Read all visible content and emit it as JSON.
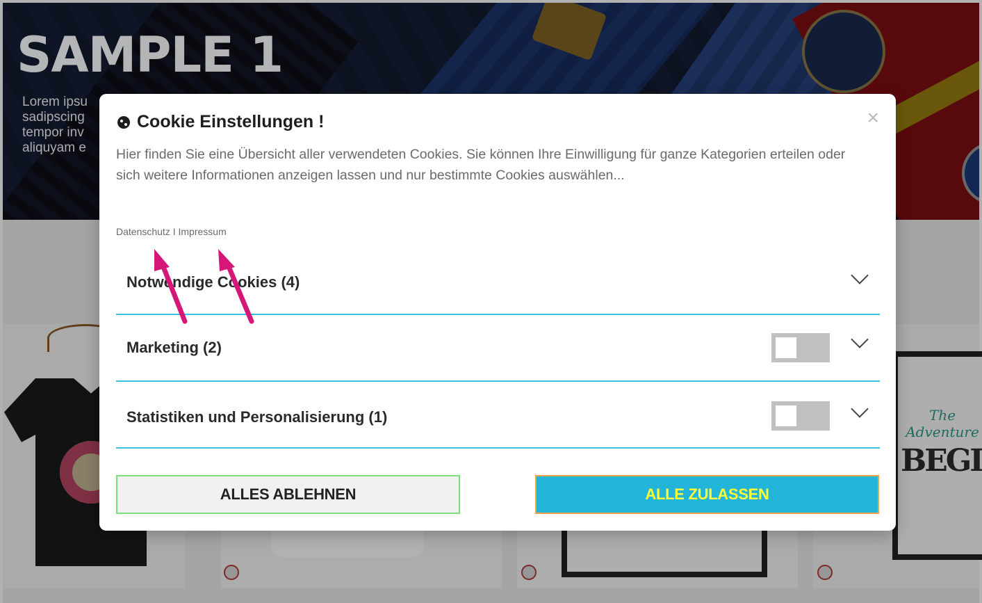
{
  "hero": {
    "title": "SAMPLE 1",
    "text": "Lorem ipsu\nsadipscing\ntempor inv\naliquyam e"
  },
  "modal": {
    "title": "Cookie Einstellungen !",
    "close": "×",
    "intro": "Hier finden Sie eine Übersicht aller verwendeten Cookies. Sie können Ihre Einwilligung für ganze Kategorien erteilen oder sich weitere Informationen anzeigen lassen und nur bestimmte Cookies auswählen...",
    "links": {
      "privacy": "Datenschutz",
      "separator": " I ",
      "imprint": "Impressum"
    },
    "categories": [
      {
        "label": "Notwendige Cookies (4)",
        "has_toggle": false
      },
      {
        "label": "Marketing (2)",
        "has_toggle": true,
        "enabled": false
      },
      {
        "label": "Statistiken und Personalisierung (1)",
        "has_toggle": true,
        "enabled": false
      }
    ],
    "buttons": {
      "reject": "ALLES ABLEHNEN",
      "accept": "ALLE ZULASSEN"
    }
  },
  "poster": {
    "small": "The Adventure",
    "big": "BEGINS"
  },
  "colors": {
    "divider": "#34c3dc",
    "accept_bg": "#22b5d9",
    "accept_text": "#ffff3a",
    "annotation_arrow": "#d6177a"
  }
}
